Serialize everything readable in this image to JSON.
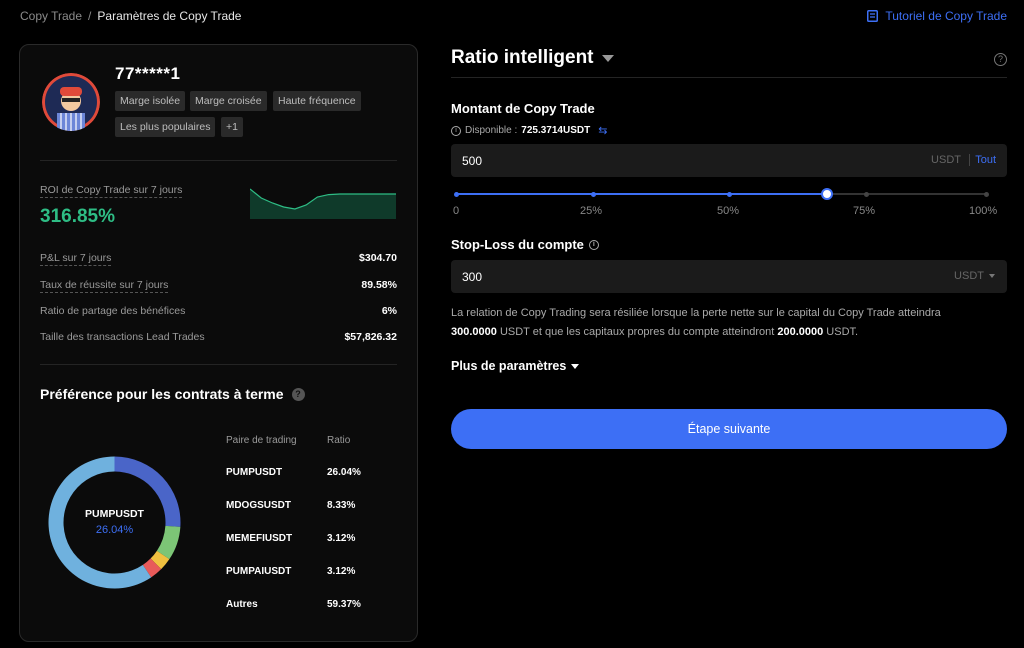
{
  "breadcrumb": {
    "root": "Copy Trade",
    "sep": "/",
    "current": "Paramètres de Copy Trade"
  },
  "tutorial_label": "Tutoriel de Copy Trade",
  "trader": {
    "username": "77*****1",
    "tags": [
      "Marge isolée",
      "Marge croisée",
      "Haute fréquence",
      "Les plus populaires",
      "+1"
    ]
  },
  "roi": {
    "label": "ROI de Copy Trade sur 7 jours",
    "value": "316.85%"
  },
  "stats": [
    {
      "label": "P&L sur 7 jours",
      "value": "$304.70"
    },
    {
      "label": "Taux de réussite sur 7 jours",
      "value": "89.58%"
    },
    {
      "label": "Ratio de partage des bénéfices",
      "value": "6%"
    },
    {
      "label": "Taille des transactions Lead Trades",
      "value": "$57,826.32"
    }
  ],
  "preference": {
    "title": "Préférence pour les contrats à terme",
    "col_pair": "Paire de trading",
    "col_ratio": "Ratio",
    "rows": [
      {
        "pair": "PUMPUSDT",
        "ratio": "26.04%"
      },
      {
        "pair": "MDOGSUSDT",
        "ratio": "8.33%"
      },
      {
        "pair": "MEMEFIUSDT",
        "ratio": "3.12%"
      },
      {
        "pair": "PUMPAIUSDT",
        "ratio": "3.12%"
      },
      {
        "pair": "Autres",
        "ratio": "59.37%"
      }
    ],
    "center_pair": "PUMPUSDT",
    "center_ratio": "26.04%"
  },
  "chart_data": {
    "type": "pie",
    "categories": [
      "PUMPUSDT",
      "MDOGSUSDT",
      "MEMEFIUSDT",
      "PUMPAIUSDT",
      "Autres"
    ],
    "values": [
      26.04,
      8.33,
      3.12,
      3.12,
      59.37
    ],
    "colors": [
      "#4a65c8",
      "#7cc576",
      "#f0c040",
      "#e85a5a",
      "#6fb1de"
    ]
  },
  "roi_sparkline": {
    "values": [
      1.0,
      0.55,
      0.3,
      0.1,
      0.0,
      0.2,
      0.6,
      0.72,
      0.75,
      0.75,
      0.75,
      0.75,
      0.75,
      0.75
    ],
    "color": "#2ebd85"
  },
  "right": {
    "mode_title": "Ratio intelligent",
    "amount": {
      "title": "Montant de Copy Trade",
      "available_label": "Disponible :",
      "available_value": "725.3714USDT",
      "value": "500",
      "unit": "USDT",
      "all": "Tout"
    },
    "slider": {
      "value_fraction": 0.7,
      "marks": [
        "0",
        "25%",
        "50%",
        "75%",
        "100%"
      ]
    },
    "stop_loss": {
      "title": "Stop-Loss du compte",
      "value": "300",
      "unit": "USDT"
    },
    "desc": {
      "p1": "La relation de Copy Trading sera résiliée lorsque la perte nette sur le capital du Copy Trade atteindra",
      "v1": "300.0000",
      "p2": " USDT et que les capitaux propres du compte atteindront ",
      "v2": "200.0000",
      "p3": " USDT."
    },
    "more_params": "Plus de paramètres",
    "next_button": "Étape suivante"
  }
}
